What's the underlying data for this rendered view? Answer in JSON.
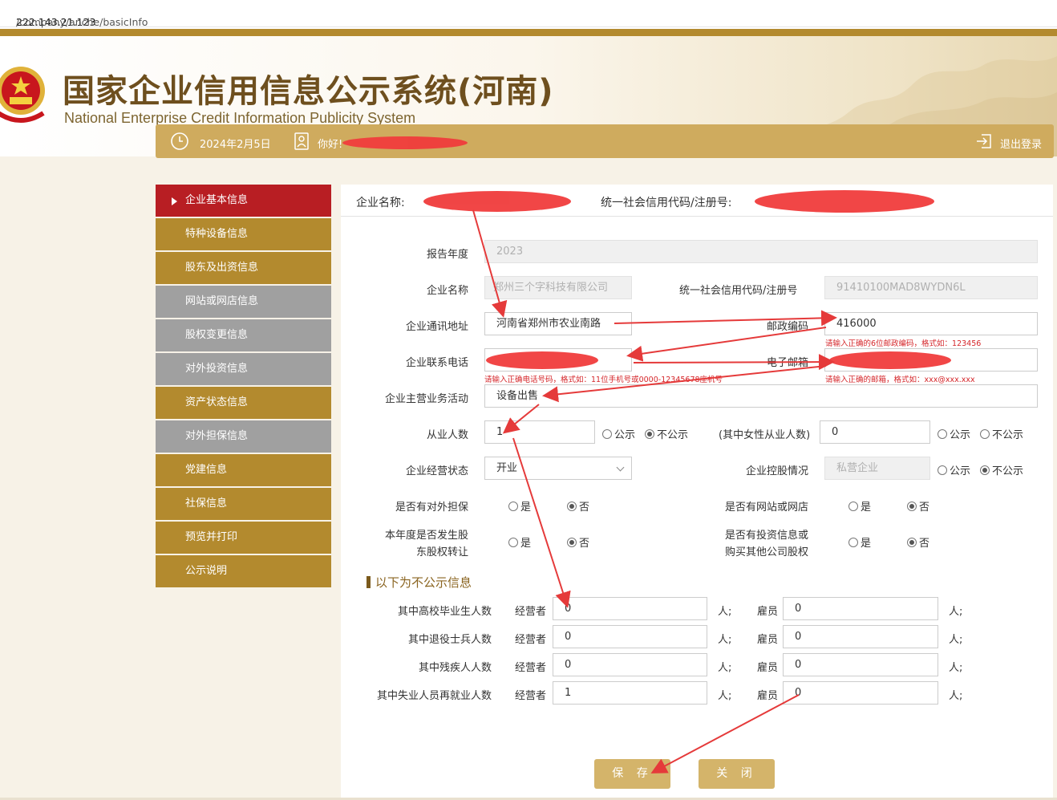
{
  "browser": {
    "url_host": "222.143.21.123",
    "url_path": "/company/anche/basicInfo"
  },
  "header": {
    "title_cn": "国家企业信用信息公示系统(河南)",
    "title_en": "National Enterprise Credit Information Publicity System",
    "date": "2024年2月5日",
    "greeting": "你好!",
    "logout": "退出登录"
  },
  "sidebar": {
    "items": [
      {
        "label": "企业基本信息",
        "state": "active"
      },
      {
        "label": "特种设备信息",
        "state": "gold"
      },
      {
        "label": "股东及出资信息",
        "state": "gold"
      },
      {
        "label": "网站或网店信息",
        "state": "gray"
      },
      {
        "label": "股权变更信息",
        "state": "gray"
      },
      {
        "label": "对外投资信息",
        "state": "gray"
      },
      {
        "label": "资产状态信息",
        "state": "gold"
      },
      {
        "label": "对外担保信息",
        "state": "gray"
      },
      {
        "label": "党建信息",
        "state": "gold"
      },
      {
        "label": "社保信息",
        "state": "gold"
      },
      {
        "label": "预览并打印",
        "state": "gold"
      },
      {
        "label": "公示说明",
        "state": "gold"
      }
    ]
  },
  "panel": {
    "company_name_label": "企业名称:",
    "credit_code_label": "统一社会信用代码/注册号:"
  },
  "form": {
    "report_year": {
      "label": "报告年度",
      "value": "2023"
    },
    "company_name": {
      "label": "企业名称",
      "value": "郑州三个字科技有限公司"
    },
    "credit_code": {
      "label": "统一社会信用代码/注册号",
      "value": "91410100MAD8WYDN6L"
    },
    "address": {
      "label": "企业通讯地址",
      "value": "河南省郑州市农业南路"
    },
    "postcode": {
      "label": "邮政编码",
      "value": "416000",
      "hint": "请输入正确的6位邮政编码，格式如：123456"
    },
    "phone": {
      "label": "企业联系电话",
      "hint": "请输入正确电话号码，格式如：11位手机号或0000-12345678座机号"
    },
    "email": {
      "label": "电子邮箱",
      "hint": "请输入正确的邮箱，格式如：xxx@xxx.xxx"
    },
    "business": {
      "label": "企业主营业务活动",
      "value": "设备出售"
    },
    "employees": {
      "label": "从业人数",
      "value": "1",
      "public": "公示",
      "not_public": "不公示"
    },
    "female_employees": {
      "label": "(其中女性从业人数)",
      "value": "0",
      "public": "公示",
      "not_public": "不公示"
    },
    "status": {
      "label": "企业经营状态",
      "value": "开业"
    },
    "control": {
      "label": "企业控股情况",
      "value": "私营企业",
      "public": "公示",
      "not_public": "不公示"
    },
    "guarantee": {
      "label": "是否有对外担保",
      "yes": "是",
      "no": "否"
    },
    "website": {
      "label": "是否有网站或网店",
      "yes": "是",
      "no": "否"
    },
    "equity_transfer": {
      "label_line1": "本年度是否发生股",
      "label_line2": "东股权转让",
      "yes": "是",
      "no": "否"
    },
    "investment": {
      "label_line1": "是否有投资信息或",
      "label_line2": "购买其他公司股权",
      "yes": "是",
      "no": "否"
    }
  },
  "nonpublic": {
    "title": "以下为不公示信息",
    "operator_label": "经营者",
    "employee_label": "雇员",
    "unit": "人;",
    "rows": [
      {
        "label": "其中高校毕业生人数",
        "operator": "0",
        "employee": "0"
      },
      {
        "label": "其中退役士兵人数",
        "operator": "0",
        "employee": "0"
      },
      {
        "label": "其中残疾人人数",
        "operator": "0",
        "employee": "0"
      },
      {
        "label": "其中失业人员再就业人数",
        "operator": "1",
        "employee": "0"
      }
    ]
  },
  "buttons": {
    "save": "保 存",
    "close": "关 闭"
  },
  "colors": {
    "gold": "#b38a2e",
    "active_red": "#b81e23",
    "gray": "#a0a0a0",
    "annotation_red": "#e53a3a"
  }
}
